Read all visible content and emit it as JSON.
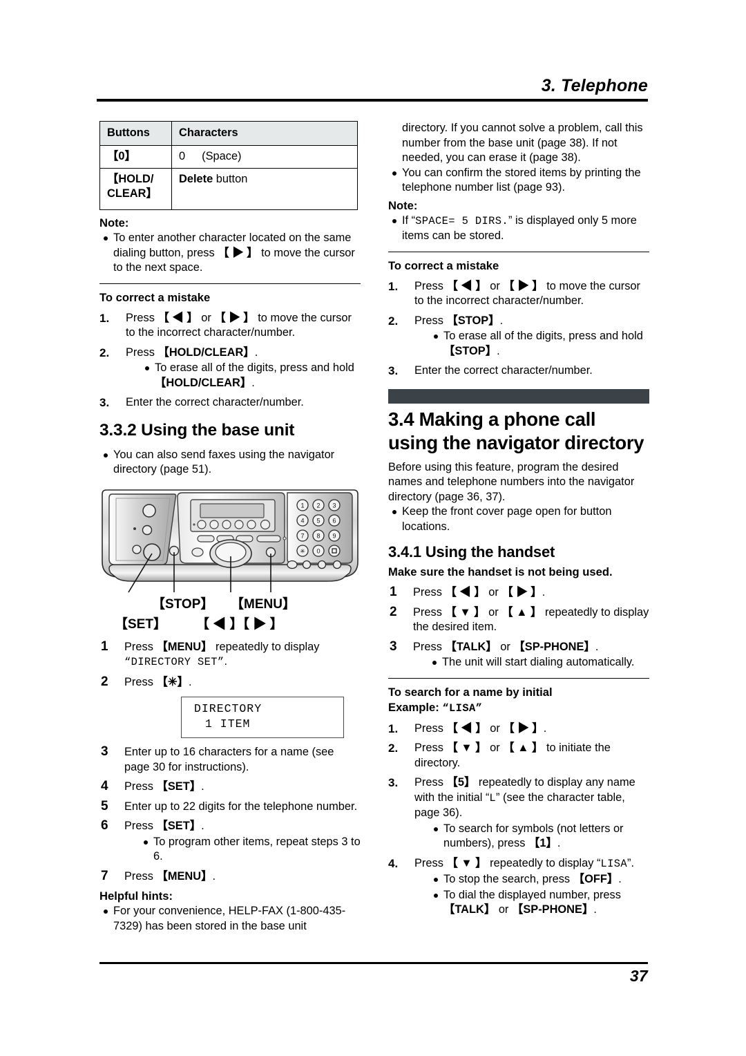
{
  "header": {
    "chapter_title": "3. Telephone"
  },
  "footer": {
    "page_number": "37"
  },
  "left_column": {
    "char_table": {
      "columns": [
        "Buttons",
        "Characters"
      ],
      "rows": [
        {
          "button": "【0】",
          "characters_lead": "0",
          "characters_rest": "(Space)",
          "bold_part": ""
        },
        {
          "button": "【HOLD/ CLEAR】",
          "bold_part": "Delete",
          "characters_rest": "button"
        }
      ]
    },
    "note_label": "Note:",
    "note_items": [
      "To enter another character located on the same dialing button, press 【 ▶ 】 to move the cursor to the next space."
    ],
    "correct_mistake_heading": "To correct a mistake",
    "correct_mistake_steps": [
      {
        "num": "1.",
        "text": "Press 【 ◀ 】 or 【 ▶ 】 to move the cursor to the incorrect character/number."
      },
      {
        "num": "2.",
        "text": "Press 【HOLD/CLEAR】.",
        "sub": [
          "To erase all of the digits, press and hold 【HOLD/CLEAR】."
        ]
      },
      {
        "num": "3.",
        "text": "Enter the correct character/number."
      }
    ],
    "section_heading": "3.3.2 Using the base unit",
    "section_bullets": [
      "You can also send faxes using the navigator directory (page 51)."
    ],
    "device_callouts": {
      "stop": "【STOP】",
      "menu": "【MENU】",
      "set": "【SET】",
      "arrows": "【 ◀ 】【 ▶ 】"
    },
    "steps": [
      {
        "num": "1",
        "text": "Press 【MENU】 repeatedly to display “DIRECTORY SET”."
      },
      {
        "num": "2",
        "text": "Press 【✳】."
      },
      {
        "num": "3",
        "text": "Enter up to 16 characters for a name (see page 30 for instructions)."
      },
      {
        "num": "4",
        "text": "Press 【SET】."
      },
      {
        "num": "5",
        "text": "Enter up to 22 digits for the telephone number."
      },
      {
        "num": "6",
        "text": "Press 【SET】.",
        "sub": [
          "To program other items, repeat steps 3 to 6."
        ]
      },
      {
        "num": "7",
        "text": "Press 【MENU】."
      }
    ],
    "lcd_display": {
      "line1": "DIRECTORY",
      "line2": "1 ITEM"
    },
    "helpful_hints_label": "Helpful hints:",
    "helpful_hints_items": [
      "For your convenience, HELP-FAX (1-800-435-7329) has been stored in the base unit"
    ]
  },
  "right_column": {
    "continuation_text": "directory. If you cannot solve a problem, call this number from the base unit (page 38). If not needed, you can erase it (page 38).",
    "top_bullets": [
      "You can confirm the stored items by printing the telephone number list (page 93)."
    ],
    "note_label": "Note:",
    "note_items": [
      "If “SPACE= 5 DIRS.” is displayed only 5 more items can be stored."
    ],
    "correct_mistake_heading": "To correct a mistake",
    "correct_mistake_steps": [
      {
        "num": "1.",
        "text": "Press 【 ◀ 】 or 【 ▶ 】 to move the cursor to the incorrect character/number."
      },
      {
        "num": "2.",
        "text": "Press 【STOP】.",
        "sub": [
          "To erase all of the digits, press and hold 【STOP】."
        ]
      },
      {
        "num": "3.",
        "text": "Enter the correct character/number."
      }
    ],
    "main_heading": "3.4 Making a phone call using the navigator directory",
    "intro_text": "Before using this feature, program the desired names and telephone numbers into the navigator directory (page 36, 37).",
    "intro_bullets": [
      "Keep the front cover page open for button locations."
    ],
    "sub_heading": "3.4.1 Using the handset",
    "sub_lead": "Make sure the handset is not being used.",
    "handset_steps": [
      {
        "num": "1",
        "text": "Press 【 ◀ 】 or 【 ▶ 】."
      },
      {
        "num": "2",
        "text": "Press 【 ▼ 】 or 【 ▲ 】 repeatedly to display the desired item."
      },
      {
        "num": "3",
        "text": "Press 【TALK】 or 【SP-PHONE】.",
        "sub": [
          "The unit will start dialing automatically."
        ]
      }
    ],
    "search_heading": "To search for a name by initial",
    "search_example_label": "Example:",
    "search_example_value": "“LISA”",
    "search_steps": [
      {
        "num": "1.",
        "text": "Press 【 ◀ 】 or 【 ▶ 】."
      },
      {
        "num": "2.",
        "text": "Press 【 ▼ 】 or 【 ▲ 】 to initiate the directory."
      },
      {
        "num": "3.",
        "text": "Press 【5】 repeatedly to display any name with the initial “L” (see the character table, page 36).",
        "sub": [
          "To search for symbols (not letters or numbers), press 【1】."
        ]
      },
      {
        "num": "4.",
        "text": "Press 【 ▼ 】 repeatedly to display “LISA”.",
        "sub": [
          "To stop the search, press 【OFF】.",
          "To dial the displayed number, press 【TALK】 or 【SP-PHONE】."
        ]
      }
    ]
  },
  "colors": {
    "table_header_bg": "#e6e9e9",
    "section_bar": "#3c4348",
    "text": "#000000"
  }
}
